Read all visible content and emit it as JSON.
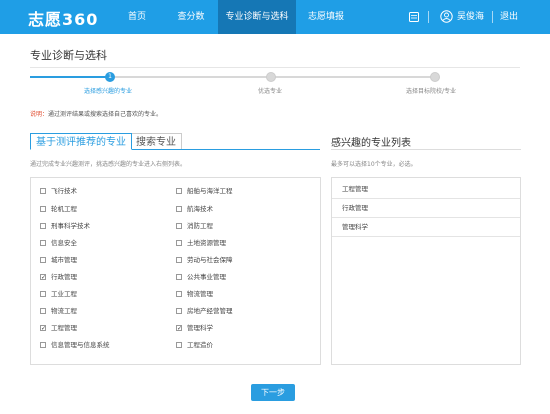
{
  "header": {
    "logo": "志愿360",
    "nav": [
      "首页",
      "查分数",
      "专业诊断与选科",
      "志愿填报"
    ],
    "active_nav": 2,
    "user": "吴俊海",
    "logout": "退出"
  },
  "page": {
    "title": "专业诊断与选科",
    "steps": [
      {
        "num": "1",
        "label": "选择感兴趣的专业"
      },
      {
        "num": "",
        "label": "优选专业"
      },
      {
        "num": "",
        "label": "选择目标院校/专业"
      }
    ],
    "note_prefix": "说明：",
    "note_text": "通过测评结果或搜索选择自己喜欢的专业。"
  },
  "tabs": {
    "recommended": "基于测评推荐的专业",
    "search": "搜索专业"
  },
  "left": {
    "hint": "通过完成专业兴趣测评，挑选感兴趣的专业进入右侧列表。",
    "options": [
      {
        "label": "飞行技术",
        "checked": false
      },
      {
        "label": "船舶与海洋工程",
        "checked": false
      },
      {
        "label": "轮机工程",
        "checked": false
      },
      {
        "label": "航海技术",
        "checked": false
      },
      {
        "label": "刑事科学技术",
        "checked": false
      },
      {
        "label": "消防工程",
        "checked": false
      },
      {
        "label": "信息安全",
        "checked": false
      },
      {
        "label": "土地资源管理",
        "checked": false
      },
      {
        "label": "城市管理",
        "checked": false
      },
      {
        "label": "劳动与社会保障",
        "checked": false
      },
      {
        "label": "行政管理",
        "checked": true
      },
      {
        "label": "公共事业管理",
        "checked": false
      },
      {
        "label": "工业工程",
        "checked": false
      },
      {
        "label": "物流管理",
        "checked": false
      },
      {
        "label": "物流工程",
        "checked": false
      },
      {
        "label": "房地产经营管理",
        "checked": false
      },
      {
        "label": "工程管理",
        "checked": true
      },
      {
        "label": "管理科学",
        "checked": true
      },
      {
        "label": "信息管理与信息系统",
        "checked": false
      },
      {
        "label": "工程造价",
        "checked": false
      }
    ]
  },
  "right": {
    "title": "感兴趣的专业列表",
    "hint": "最多可以选择10个专业，必选。",
    "selected": [
      "工程管理",
      "行政管理",
      "管理科学"
    ]
  },
  "next_button": "下一步",
  "colors": {
    "header_bg": "#1f9ee6",
    "accent": "#2a9de0",
    "warn": "#e04b2e"
  }
}
